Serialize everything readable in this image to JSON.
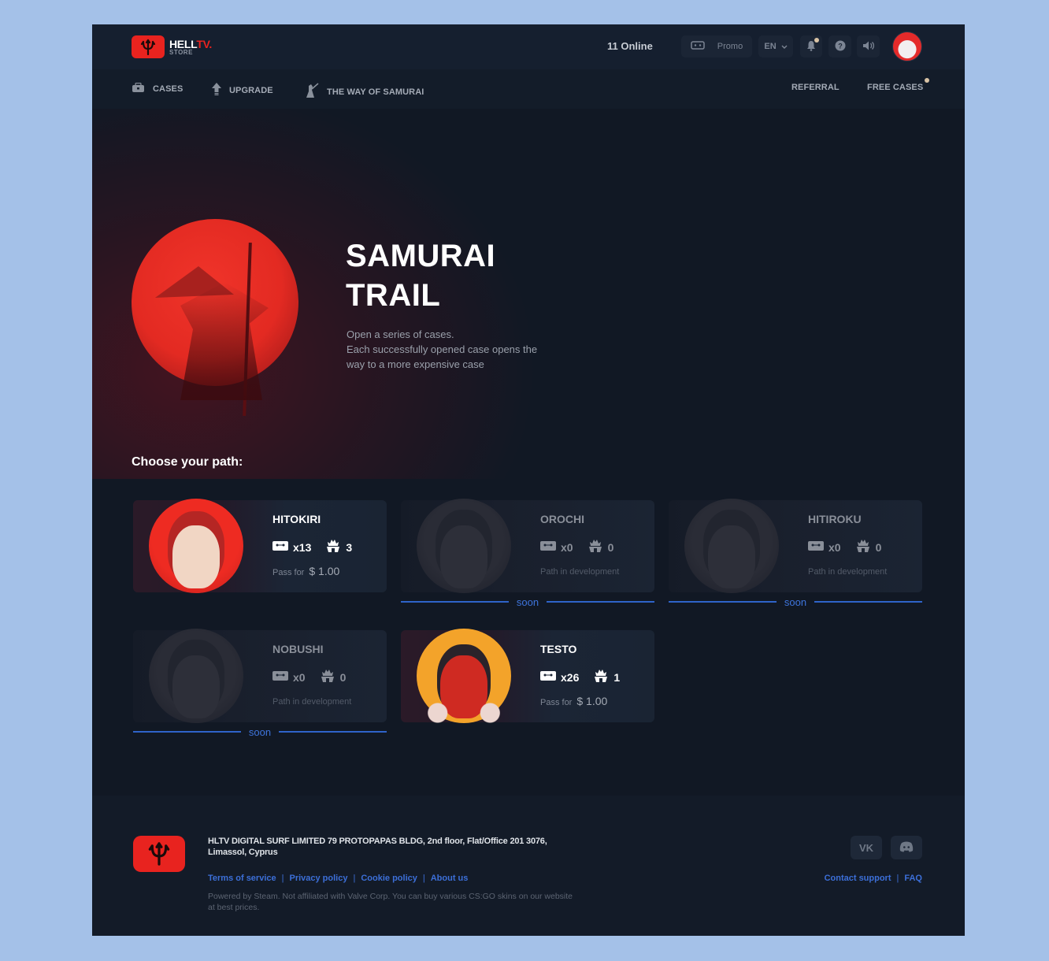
{
  "header": {
    "logo_main": "HELL",
    "logo_accent": "TV.",
    "logo_sub": "STORE",
    "online": "11 Online",
    "promo_label": "Promo",
    "lang": "EN",
    "chevron": "⌄",
    "icons": {
      "promo": "ticket-icon",
      "bell": "bell-icon",
      "help": "question-icon",
      "sound": "speaker-icon",
      "avatar": "user-avatar"
    }
  },
  "nav": {
    "items": [
      {
        "label": "CASES",
        "icon": "case-icon"
      },
      {
        "label": "UPGRADE",
        "icon": "upgrade-arrow-icon"
      },
      {
        "label": "THE WAY OF SAMURAI",
        "icon": "samurai-icon"
      }
    ],
    "right": [
      {
        "label": "REFERRAL"
      },
      {
        "label": "FREE CASES"
      }
    ]
  },
  "hero": {
    "title_line1": "SAMURAI",
    "title_line2": "TRAIL",
    "desc_line1": "Open a series of cases.",
    "desc_line2": "Each successfully opened case opens the",
    "desc_line3": "way to a more expensive case"
  },
  "paths": {
    "title": "Choose your path:",
    "pass_label": "Pass for",
    "dev_label": "Path in development",
    "soon_label": "soon",
    "items": [
      {
        "name": "HITOKIRI",
        "cases": "x13",
        "level": "3",
        "price": "$ 1.00",
        "status": "available"
      },
      {
        "name": "OROCHI",
        "cases": "x0",
        "level": "0",
        "status": "soon"
      },
      {
        "name": "HITIROKU",
        "cases": "x0",
        "level": "0",
        "status": "soon"
      },
      {
        "name": "NOBUSHI",
        "cases": "x0",
        "level": "0",
        "status": "soon"
      },
      {
        "name": "TESTO",
        "cases": "x26",
        "level": "1",
        "price": "$ 1.00",
        "status": "available"
      }
    ]
  },
  "footer": {
    "address": "HLTV DIGITAL SURF LIMITED 79 PROTOPAPAS BLDG, 2nd floor, Flat/Office 201 3076, Limassol, Cyprus",
    "links": [
      "Terms of service",
      "Privacy policy",
      "Cookie policy",
      "About us"
    ],
    "legal": "Powered by Steam. Not affiliated with Valve Corp. You can buy various CS:GO skins on our website at best prices.",
    "social": [
      "VK",
      "Discord"
    ],
    "vk_glyph": "VK",
    "discord_glyph": "◉",
    "right_links": [
      "Contact support",
      "FAQ"
    ],
    "separator": "|"
  },
  "colors": {
    "brand_red": "#e8231f",
    "link_blue": "#3c6fd8",
    "soon_blue": "#2f63c9",
    "background": "#111824"
  }
}
